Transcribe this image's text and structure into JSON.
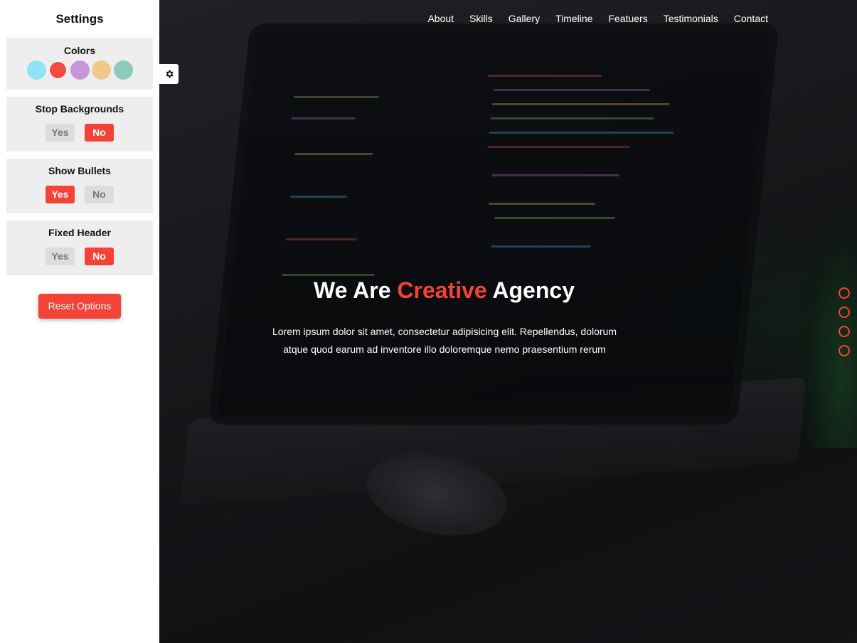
{
  "settings": {
    "title": "Settings",
    "colors": {
      "label": "Colors",
      "swatches": [
        "#8ee3f5",
        "#f44336",
        "#c896d8",
        "#f2c88a",
        "#8ec9bd"
      ],
      "active": "#f44336"
    },
    "stop_backgrounds": {
      "label": "Stop Backgrounds",
      "yes": "Yes",
      "no": "No",
      "selected": "No"
    },
    "show_bullets": {
      "label": "Show Bullets",
      "yes": "Yes",
      "no": "No",
      "selected": "Yes"
    },
    "fixed_header": {
      "label": "Fixed Header",
      "yes": "Yes",
      "no": "No",
      "selected": "No"
    },
    "reset_label": "Reset Options",
    "toggle_icon": "gear-icon"
  },
  "nav": {
    "items": [
      "About",
      "Skills",
      "Gallery",
      "Timeline",
      "Featuers",
      "Testimonials",
      "Contact"
    ]
  },
  "hero": {
    "title_part1": "We Are ",
    "title_accent": "Creative",
    "title_part2": " Agency",
    "text": "Lorem ipsum dolor sit amet, consectetur adipisicing elit. Repellendus, dolorum atque quod earum ad inventore illo doloremque nemo praesentium rerum",
    "accent_color": "#f44336"
  },
  "bullets": {
    "count": 4
  }
}
